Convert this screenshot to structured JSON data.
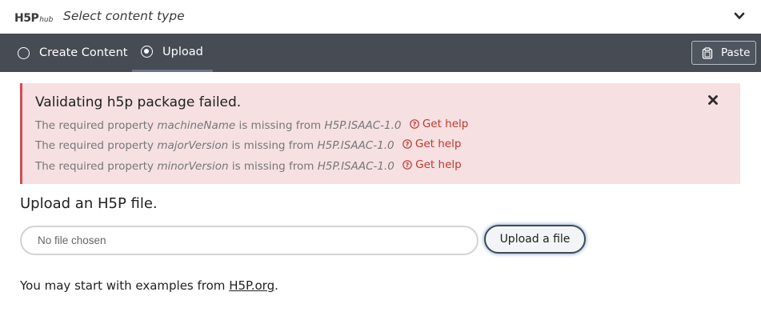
{
  "header": {
    "logo_text": "H5P",
    "logo_suffix": "hub",
    "title": "Select content type",
    "chevron_icon": "chevron-down-icon"
  },
  "tabs": [
    {
      "label": "Create Content",
      "selected": false
    },
    {
      "label": "Upload",
      "selected": true
    }
  ],
  "paste": {
    "label": "Paste",
    "icon": "clipboard-icon"
  },
  "error": {
    "title": "Validating h5p package failed.",
    "close_icon": "close-icon",
    "accent_color": "#d34b53",
    "background_color": "#f6e0e2",
    "lines": [
      {
        "prefix": "The required property",
        "property": "machineName",
        "middle": "is missing from",
        "library": "H5P.ISAAC-1.0",
        "help_label": "Get help"
      },
      {
        "prefix": "The required property",
        "property": "majorVersion",
        "middle": "is missing from",
        "library": "H5P.ISAAC-1.0",
        "help_label": "Get help"
      },
      {
        "prefix": "The required property",
        "property": "minorVersion",
        "middle": "is missing from",
        "library": "H5P.ISAAC-1.0",
        "help_label": "Get help"
      }
    ]
  },
  "upload": {
    "heading": "Upload an H5P file.",
    "file_placeholder": "No file chosen",
    "button_label": "Upload a file"
  },
  "examples": {
    "prefix": "You may start with examples from",
    "link_label": "H5P.org",
    "suffix": "."
  }
}
